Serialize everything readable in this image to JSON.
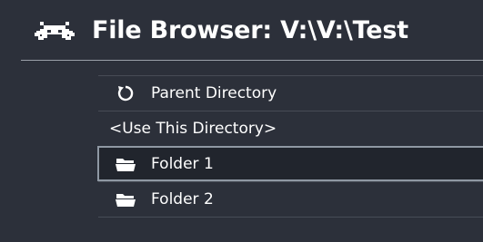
{
  "header": {
    "logo_icon": "retroarch-invader-icon",
    "title": "File Browser: V:\\V:\\Test"
  },
  "list": {
    "items": [
      {
        "label": "Parent Directory",
        "icon": "refresh-icon",
        "selected": false
      },
      {
        "label": "<Use This Directory>",
        "icon": "",
        "selected": false
      },
      {
        "label": "Folder 1",
        "icon": "folder-icon",
        "selected": true
      },
      {
        "label": "Folder 2",
        "icon": "folder-icon",
        "selected": false
      }
    ]
  },
  "colors": {
    "background": "#2c303a",
    "selection": "#21252d",
    "selection_border": "#8f98a3",
    "divider": "#474c56",
    "text": "#ffffff"
  }
}
